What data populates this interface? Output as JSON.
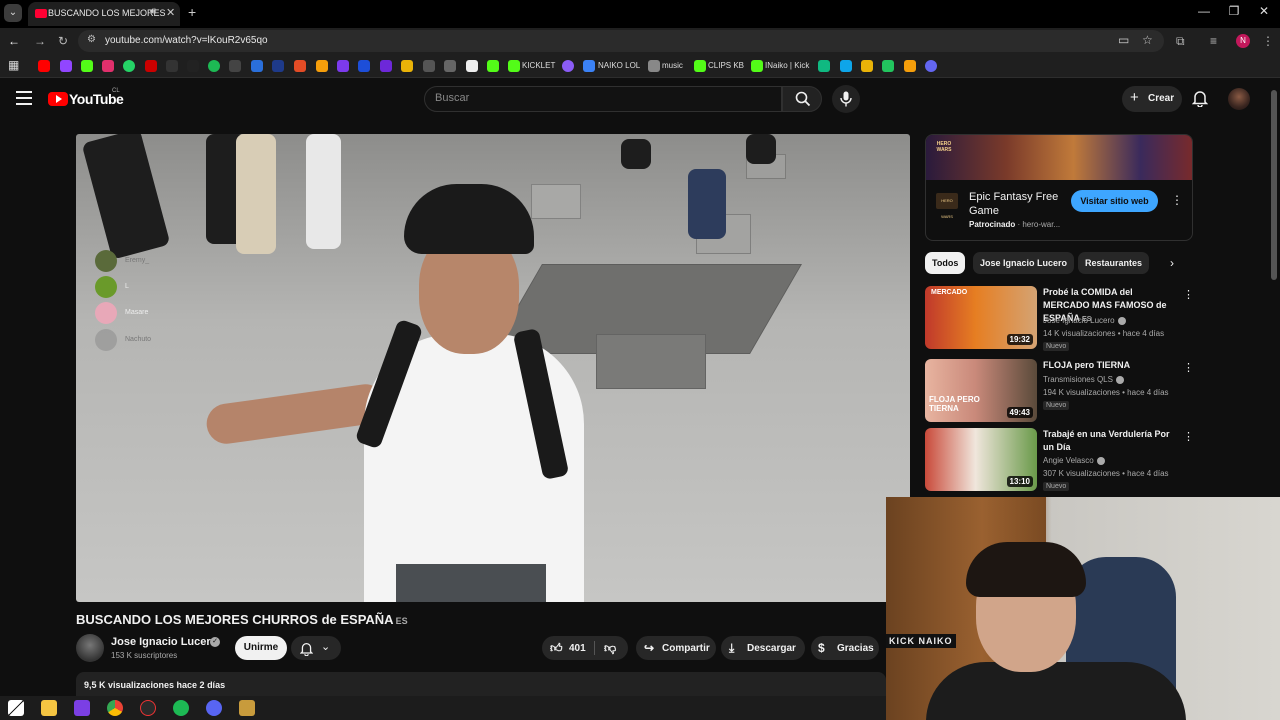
{
  "browser": {
    "tab_title": "BUSCANDO LOS MEJORES",
    "url": "youtube.com/watch?v=lKouR2v65qo",
    "profile_initial": "N",
    "bookmarks": [
      "KICKLET",
      "NAIKO LOL",
      "music",
      "CLIPS KB",
      "INaiko | Kick"
    ]
  },
  "header": {
    "logo": "YouTube",
    "country": "CL",
    "search_placeholder": "Buscar",
    "create_label": "Crear"
  },
  "overlay_chat": [
    "Eremy_",
    "L",
    "Masare",
    "Nachuto"
  ],
  "video": {
    "title": "BUSCANDO LOS MEJORES CHURROS de ESPAÑA",
    "title_lang": "ES",
    "channel": "Jose Ignacio Lucero",
    "subscribers": "153 K suscriptores",
    "join_label": "Unirme",
    "likes": "401",
    "share_label": "Compartir",
    "download_label": "Descargar",
    "thanks_label": "Gracias",
    "views_date": "9,5 K visualizaciones  hace 2 días"
  },
  "ad": {
    "banner_text": "HERO WARS",
    "title": "Epic Fantasy Free Game",
    "sponsored": "Patrocinado",
    "domain": "hero-war...",
    "cta": "Visitar sitio web"
  },
  "chips": [
    "Todos",
    "Jose Ignacio Lucero",
    "Restaurantes"
  ],
  "related": [
    {
      "title": "Probé la COMIDA del MERCADO MAS FAMOSO de ESPAÑA",
      "title_lang": "ES",
      "channel": "Jose Ignacio Lucero",
      "views": "14 K visualizaciones • hace 4 días",
      "badge": "Nuevo",
      "duration": "19:32",
      "thumb_text": "MERCADO"
    },
    {
      "title": "FLOJA pero TIERNA",
      "title_lang": "",
      "channel": "Transmisiones QLS",
      "views": "194 K visualizaciones • hace 4 días",
      "badge": "Nuevo",
      "duration": "49:43",
      "thumb_text": "FLOJA PERO TIERNA"
    },
    {
      "title": "Trabajé en una Verdulería Por un Día",
      "title_lang": "",
      "channel": "Angie Velasco",
      "views": "307 K visualizaciones • hace 4 días",
      "badge": "Nuevo",
      "duration": "13:10",
      "thumb_text": ""
    }
  ],
  "webcam_sticker": "KICK NAIKO",
  "colors": {
    "background": "#0f0f0f",
    "accent_red": "#ff0000",
    "cta_blue": "#3ea6ff"
  }
}
